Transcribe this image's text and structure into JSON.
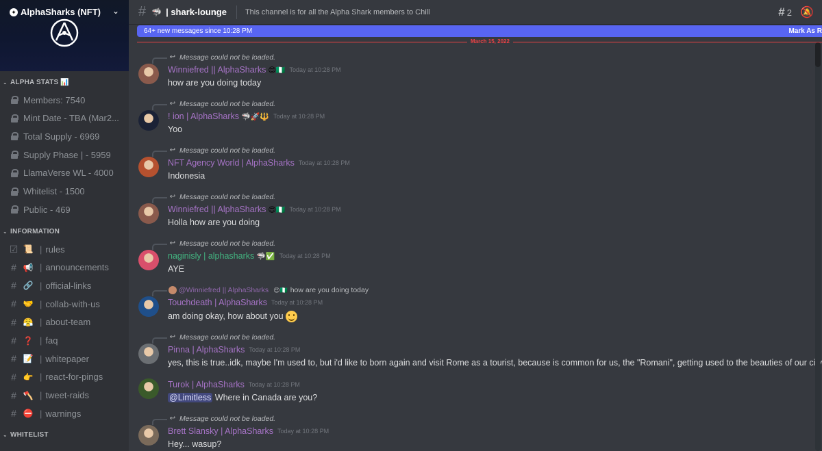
{
  "server": {
    "name": "AlphaSharks (NFT)",
    "logo_icon": "alpha-triangle-logo"
  },
  "sidebar": {
    "categories": [
      {
        "name": "ALPHA STATS 📊",
        "items": [
          {
            "label": "Members: 7540",
            "icon": "lock-icon"
          },
          {
            "label": "Mint Date - TBA (Mar2...",
            "icon": "lock-icon"
          },
          {
            "label": "Total Supply - 6969",
            "icon": "lock-icon"
          },
          {
            "label": "Supply Phase  |  - 5959",
            "icon": "lock-icon"
          },
          {
            "label": "LlamaVerse WL - 4000",
            "icon": "lock-icon"
          },
          {
            "label": "Whitelist - 1500",
            "icon": "lock-icon"
          },
          {
            "label": "Public - 469",
            "icon": "lock-icon"
          }
        ]
      },
      {
        "name": "INFORMATION",
        "items": [
          {
            "label": "rules",
            "emoji": "📜",
            "icon": "rules-checkbox-icon"
          },
          {
            "label": "announcements",
            "emoji": "📢",
            "icon": "hash-icon"
          },
          {
            "label": "official-links",
            "emoji": "🔗",
            "icon": "hash-icon"
          },
          {
            "label": "collab-with-us",
            "emoji": "🤝",
            "icon": "hash-icon"
          },
          {
            "label": "about-team",
            "emoji": "😤",
            "icon": "hash-icon"
          },
          {
            "label": "faq",
            "emoji": "❓",
            "icon": "hash-icon"
          },
          {
            "label": "whitepaper",
            "emoji": "📝",
            "icon": "hash-icon"
          },
          {
            "label": "react-for-pings",
            "emoji": "👉",
            "icon": "hash-icon"
          },
          {
            "label": "tweet-raids",
            "emoji": "🪓",
            "icon": "hash-icon"
          },
          {
            "label": "warnings",
            "emoji": "⛔",
            "icon": "hash-icon"
          }
        ]
      },
      {
        "name": "WHITELIST",
        "items": []
      }
    ]
  },
  "header": {
    "channel_emoji": "🦈",
    "channel_name": "| shark-lounge",
    "topic": "This channel is for all the Alpha Shark members to Chill",
    "threads_count": "2"
  },
  "new_messages": {
    "text": "64+ new messages since 10:28 PM",
    "mark_label": "Mark As R"
  },
  "date_divider": "March 15, 2022",
  "messages": [
    {
      "reply": "Message could not be loaded.",
      "author": "Winniefred || AlphaSharks",
      "author_color": "#a673c6",
      "emojis": "😍🇳🇬",
      "time": "Today at 10:28 PM",
      "text": "how are you doing today",
      "avatar_color": "#8a5a4c"
    },
    {
      "reply": "Message could not be loaded.",
      "author": "! ion | AlphaSharks",
      "author_color": "#a673c6",
      "emojis": "🦈🚀🔱",
      "time": "Today at 10:28 PM",
      "text": "Yoo",
      "avatar_color": "#1b2236"
    },
    {
      "reply": "Message could not be loaded.",
      "author": "NFT Agency World | AlphaSharks",
      "author_color": "#a673c6",
      "emojis": "",
      "time": "Today at 10:28 PM",
      "text": "Indonesia",
      "avatar_color": "#b5512f"
    },
    {
      "reply": "Message could not be loaded.",
      "author": "Winniefred || AlphaSharks",
      "author_color": "#a673c6",
      "emojis": "😍🇳🇬",
      "time": "Today at 10:28 PM",
      "text": "Holla how are you doing",
      "avatar_color": "#8a5a4c"
    },
    {
      "reply": "Message could not be loaded.",
      "author": "naginisly | alphasharks",
      "author_color": "#43b581",
      "emojis": "🦈✅",
      "time": "Today at 10:28 PM",
      "text": "AYE",
      "avatar_color": "#d94f6b"
    },
    {
      "reply_author": "@Winniefred || AlphaSharks",
      "reply_emojis": "😍🇳🇬",
      "reply": "how are you doing today",
      "author": "Touchdeath | AlphaSharks",
      "author_color": "#a673c6",
      "emojis": "",
      "time": "Today at 10:28 PM",
      "text": "am doing okay, how about you",
      "avatar_color": "#1f4f8a"
    },
    {
      "reply": "Message could not be loaded.",
      "author": "Pinna | AlphaSharks",
      "author_color": "#a673c6",
      "emojis": "",
      "time": "Today at 10:28 PM",
      "text": "yes, this is true..idk, maybe I'm used to, but i'd like to born again and visit Rome as a tourist, because is common for us, the \"Romani\", getting used to the beauties of our city",
      "avatar_color": "#6b6f73"
    },
    {
      "reply": "",
      "author": "Turok | AlphaSharks",
      "author_color": "#a673c6",
      "emojis": "",
      "time": "Today at 10:28 PM",
      "mention": "@Limitless",
      "text": "Where in Canada are you?",
      "avatar_color": "#3a5a2a"
    },
    {
      "reply": "Message could not be loaded.",
      "author": "Brett Slansky | AlphaSharks",
      "author_color": "#a673c6",
      "emojis": "",
      "time": "Today at 10:28 PM",
      "text": "Hey... wasup?",
      "avatar_color": "#7a6a5a"
    }
  ]
}
